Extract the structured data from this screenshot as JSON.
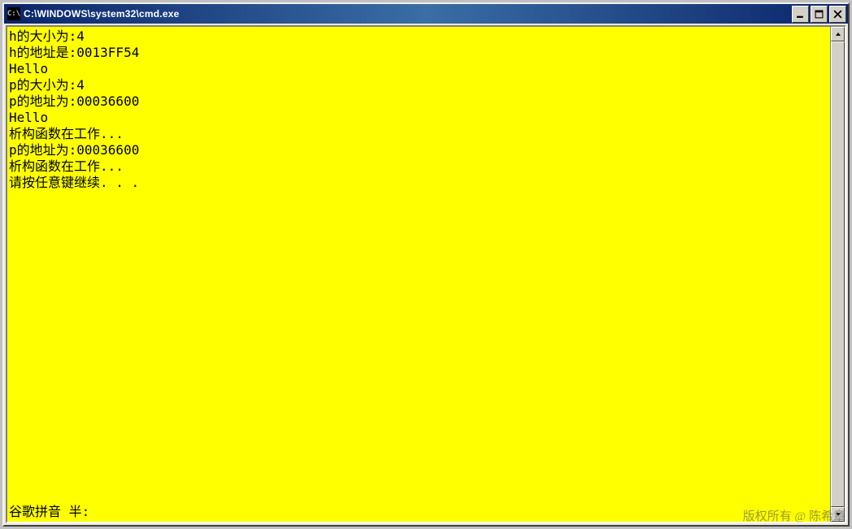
{
  "window": {
    "title": "C:\\WINDOWS\\system32\\cmd.exe",
    "icon_label": "C:\\"
  },
  "console": {
    "lines": [
      "h的大小为:4",
      "h的地址是:0013FF54",
      "Hello",
      "p的大小为:4",
      "p的地址为:00036600",
      "Hello",
      "析构函数在工作...",
      "p的地址为:00036600",
      "析构函数在工作...",
      "请按任意键继续. . ."
    ],
    "ime": "谷歌拼音  半:"
  },
  "watermark": "版权所有 @ 陈希章"
}
